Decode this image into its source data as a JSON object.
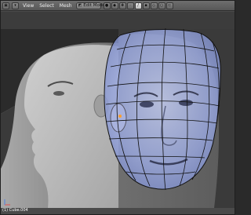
{
  "header": {
    "editor_type_icon": "3d-view-icon",
    "menus": [
      "View",
      "Select",
      "Mesh"
    ],
    "mode_icon": "edit-mode-icon",
    "mode_label": "Edit Mode",
    "tools": [
      {
        "icon": "solid-shading-icon",
        "glyph": "●"
      },
      {
        "icon": "pivot-icon",
        "glyph": "◆"
      },
      {
        "icon": "manipulator-icon",
        "glyph": "✚"
      },
      {
        "icon": "vertex-select-icon",
        "glyph": "·"
      },
      {
        "icon": "edge-select-icon",
        "glyph": "/"
      },
      {
        "icon": "face-select-icon",
        "glyph": "▪"
      },
      {
        "icon": "limit-selection-icon",
        "glyph": "◇"
      },
      {
        "icon": "proportional-edit-icon",
        "glyph": "○"
      },
      {
        "icon": "snap-icon",
        "glyph": "⊂"
      }
    ]
  },
  "viewport": {
    "overlay_color": "#7f93d6",
    "wire_color": "#111111"
  },
  "status": {
    "object_label": "(1) Cube.004"
  }
}
